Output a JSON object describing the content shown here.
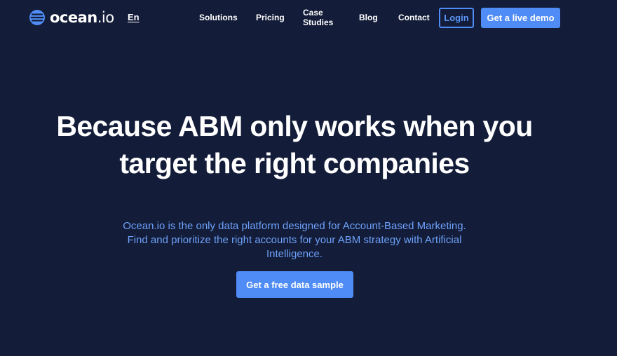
{
  "header": {
    "logo": {
      "text_main": "ocean",
      "text_suffix": ".io",
      "icon": "ocean-waves-icon"
    },
    "language": "En",
    "nav": {
      "solutions": "Solutions",
      "pricing": "Pricing",
      "case_studies_line1": "Case",
      "case_studies_line2": "Studies",
      "blog": "Blog",
      "contact": "Contact"
    },
    "login_label": "Login",
    "demo_label": "Get a live demo"
  },
  "hero": {
    "headline_line1": "Because ABM only works when you",
    "headline_line2": "target the right companies",
    "subtext_line1": "Ocean.io is the only data platform designed for Account-Based Marketing.",
    "subtext_line2": "Find and prioritize the right accounts for your ABM strategy with Artificial",
    "subtext_line3": "Intelligence.",
    "cta_label": "Get a free data sample"
  },
  "colors": {
    "background": "#131c38",
    "accent": "#4f8cf5",
    "subtext": "#6ea2fb",
    "text": "#ffffff"
  }
}
